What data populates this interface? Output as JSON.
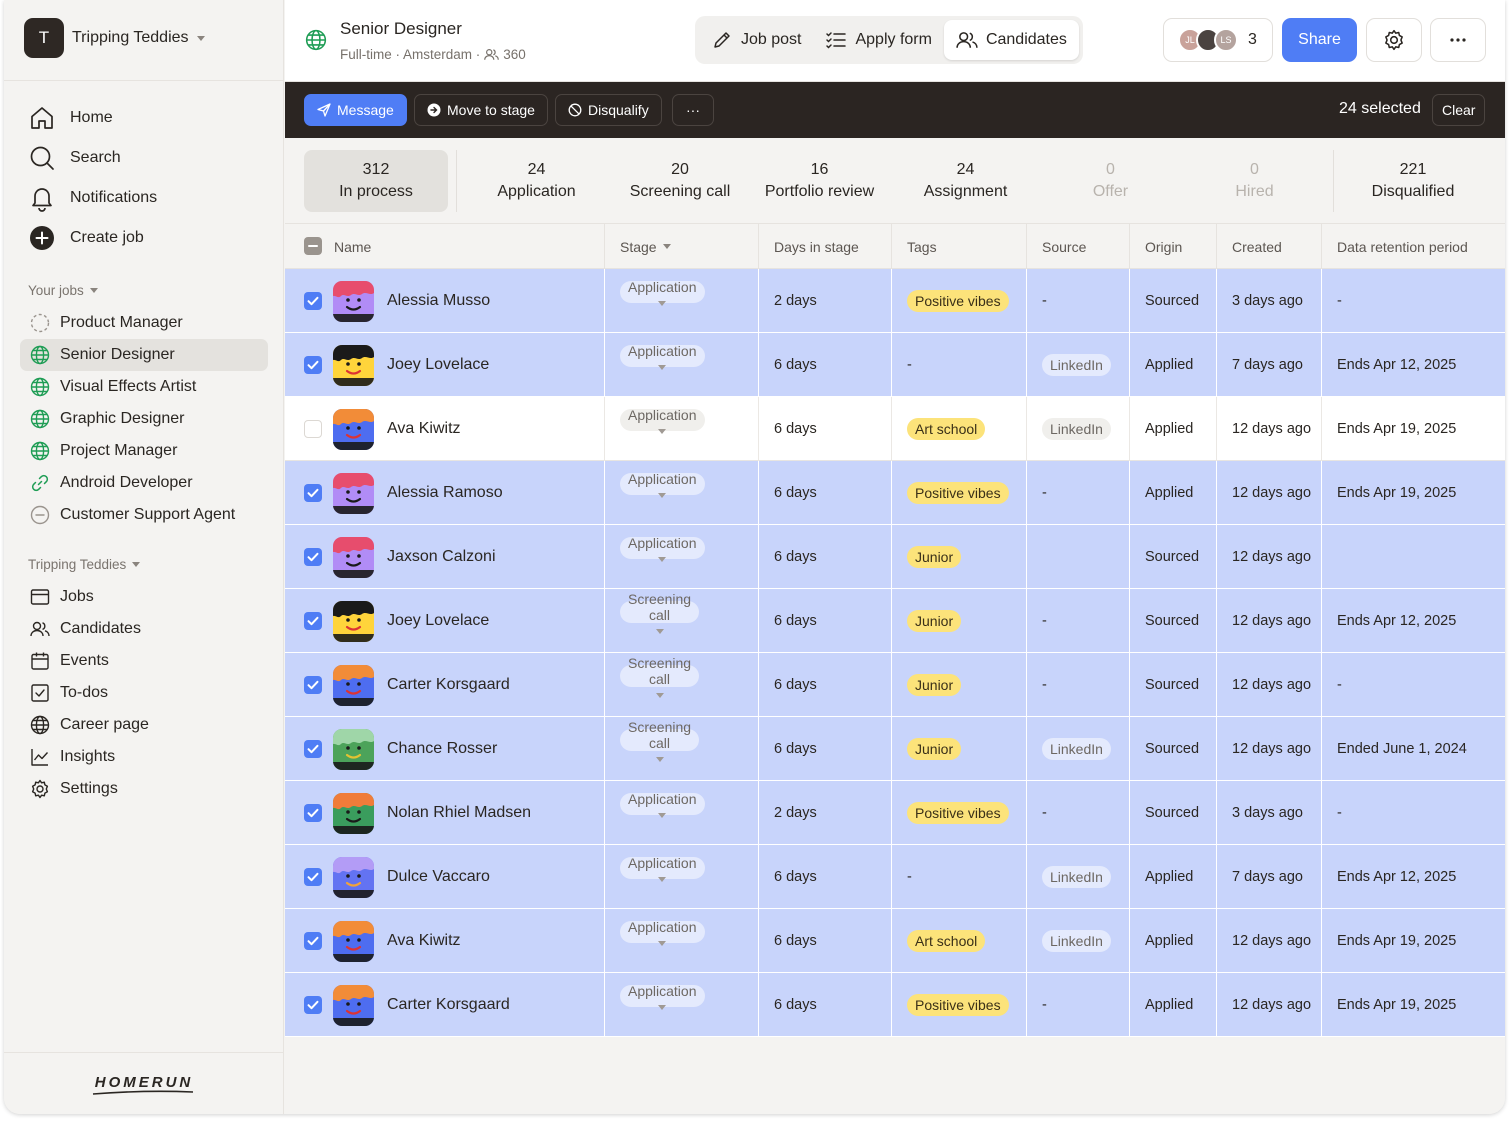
{
  "workspace": {
    "initial": "T",
    "name": "Tripping Teddies"
  },
  "nav": [
    {
      "label": "Home",
      "icon": "home-icon"
    },
    {
      "label": "Search",
      "icon": "search-icon"
    },
    {
      "label": "Notifications",
      "icon": "bell-icon"
    },
    {
      "label": "Create job",
      "icon": "plus-circle-icon"
    }
  ],
  "your_jobs": {
    "title": "Your jobs",
    "items": [
      {
        "label": "Product Manager",
        "icon": "dashed-circle-icon",
        "active": false
      },
      {
        "label": "Senior Designer",
        "icon": "globe-icon",
        "active": true
      },
      {
        "label": "Visual Effects Artist",
        "icon": "globe-icon",
        "active": false
      },
      {
        "label": "Graphic Designer",
        "icon": "globe-icon",
        "active": false
      },
      {
        "label": "Project Manager",
        "icon": "globe-icon",
        "active": false
      },
      {
        "label": "Android Developer",
        "icon": "link-icon",
        "active": false
      },
      {
        "label": "Customer Support Agent",
        "icon": "minus-circle-icon",
        "active": false
      }
    ]
  },
  "org": {
    "title": "Tripping Teddies",
    "items": [
      {
        "label": "Jobs",
        "icon": "jobs-icon"
      },
      {
        "label": "Candidates",
        "icon": "users-icon"
      },
      {
        "label": "Events",
        "icon": "calendar-icon"
      },
      {
        "label": "To-dos",
        "icon": "checkbox-icon"
      },
      {
        "label": "Career page",
        "icon": "globe-icon"
      },
      {
        "label": "Insights",
        "icon": "chart-icon"
      },
      {
        "label": "Settings",
        "icon": "gear-icon"
      }
    ]
  },
  "logo": "HOMERUN",
  "job": {
    "title": "Senior Designer",
    "subtitle": "Full-time · Amsterdam ·",
    "applicants": "360"
  },
  "tabs": [
    {
      "label": "Job post",
      "icon": "pencil-icon",
      "active": false
    },
    {
      "label": "Apply form",
      "icon": "list-check-icon",
      "active": false
    },
    {
      "label": "Candidates",
      "icon": "users-icon",
      "active": true
    }
  ],
  "collaborators": {
    "avatars": [
      {
        "text": "JL",
        "color": "#c9a29a"
      },
      {
        "text": "",
        "color": "#4a4340"
      },
      {
        "text": "LS",
        "color": "#b4a39e"
      }
    ],
    "count": "3"
  },
  "share_label": "Share",
  "actions": {
    "message": "Message",
    "move": "Move to stage",
    "disqualify": "Disqualify",
    "more": "···",
    "selected": "24 selected",
    "clear": "Clear"
  },
  "stages": [
    {
      "count": "312",
      "label": "In process",
      "active": true,
      "muted": false
    },
    {
      "count": "24",
      "label": "Application",
      "active": false,
      "muted": false
    },
    {
      "count": "20",
      "label": "Screening call",
      "active": false,
      "muted": false
    },
    {
      "count": "16",
      "label": "Portfolio review",
      "active": false,
      "muted": false
    },
    {
      "count": "24",
      "label": "Assignment",
      "active": false,
      "muted": false
    },
    {
      "count": "0",
      "label": "Offer",
      "active": false,
      "muted": true
    },
    {
      "count": "0",
      "label": "Hired",
      "active": false,
      "muted": true
    },
    {
      "count": "221",
      "label": "Disqualified",
      "active": false,
      "muted": false
    }
  ],
  "columns": [
    "Name",
    "Stage",
    "Days in stage",
    "Tags",
    "Source",
    "Origin",
    "Created",
    "Data retention period"
  ],
  "colors": {
    "accent": "#4f7df5",
    "selected_row": "#c8d4fb",
    "tag": "#fce37a"
  },
  "rows": [
    {
      "selected": true,
      "name": "Alessia Musso",
      "avatar": "purple",
      "stage": "Application",
      "days": "2 days",
      "tag": "Positive vibes",
      "source": "-",
      "source_pill": false,
      "origin": "Sourced",
      "created": "3 days ago",
      "retention": "-"
    },
    {
      "selected": true,
      "name": "Joey Lovelace",
      "avatar": "yellow",
      "stage": "Application",
      "days": "6 days",
      "tag": "-",
      "source": "LinkedIn",
      "source_pill": true,
      "origin": "Applied",
      "created": "7 days ago",
      "retention": "Ends Apr 12, 2025"
    },
    {
      "selected": false,
      "name": "Ava Kiwitz",
      "avatar": "blue",
      "stage": "Application",
      "days": "6 days",
      "tag": "Art school",
      "source": "LinkedIn",
      "source_pill": true,
      "origin": "Applied",
      "created": "12 days ago",
      "retention": "Ends Apr 19, 2025"
    },
    {
      "selected": true,
      "name": "Alessia Ramoso",
      "avatar": "purple",
      "stage": "Application",
      "days": "6 days",
      "tag": "Positive vibes",
      "source": "-",
      "source_pill": false,
      "origin": "Applied",
      "created": "12 days ago",
      "retention": "Ends Apr 19, 2025"
    },
    {
      "selected": true,
      "name": "Jaxson Calzoni",
      "avatar": "purple",
      "stage": "Application",
      "days": "6 days",
      "tag": "Junior",
      "source": "",
      "source_pill": false,
      "origin": "Sourced",
      "created": "12 days ago",
      "retention": ""
    },
    {
      "selected": true,
      "name": "Joey Lovelace",
      "avatar": "yellow",
      "stage": "Screening call",
      "days": "6 days",
      "tag": "Junior",
      "source": "-",
      "source_pill": false,
      "origin": "Sourced",
      "created": "12 days ago",
      "retention": "Ends Apr 12, 2025"
    },
    {
      "selected": true,
      "name": "Carter Korsgaard",
      "avatar": "blue",
      "stage": "Screening call",
      "days": "6 days",
      "tag": "Junior",
      "source": "-",
      "source_pill": false,
      "origin": "Sourced",
      "created": "12 days ago",
      "retention": "-"
    },
    {
      "selected": true,
      "name": "Chance Rosser",
      "avatar": "green",
      "stage": "Screening call",
      "days": "6 days",
      "tag": "Junior",
      "source": "LinkedIn",
      "source_pill": true,
      "origin": "Sourced",
      "created": "12 days ago",
      "retention": "Ended June 1, 2024"
    },
    {
      "selected": true,
      "name": "Nolan Rhiel Madsen",
      "avatar": "darkgreen",
      "stage": "Application",
      "days": "2 days",
      "tag": "Positive vibes",
      "source": "-",
      "source_pill": false,
      "origin": "Sourced",
      "created": "3 days ago",
      "retention": "-"
    },
    {
      "selected": true,
      "name": "Dulce Vaccaro",
      "avatar": "bluepurple",
      "stage": "Application",
      "days": "6 days",
      "tag": "-",
      "source": "LinkedIn",
      "source_pill": true,
      "origin": "Applied",
      "created": "7 days ago",
      "retention": "Ends Apr 12, 2025"
    },
    {
      "selected": true,
      "name": "Ava Kiwitz",
      "avatar": "blue",
      "stage": "Application",
      "days": "6 days",
      "tag": "Art school",
      "source": "LinkedIn",
      "source_pill": true,
      "origin": "Applied",
      "created": "12 days ago",
      "retention": "Ends Apr 19, 2025"
    },
    {
      "selected": true,
      "name": "Carter Korsgaard",
      "avatar": "blue",
      "stage": "Application",
      "days": "6 days",
      "tag": "Positive vibes",
      "source": "-",
      "source_pill": false,
      "origin": "Applied",
      "created": "12 days ago",
      "retention": "Ends Apr 19, 2025"
    }
  ]
}
